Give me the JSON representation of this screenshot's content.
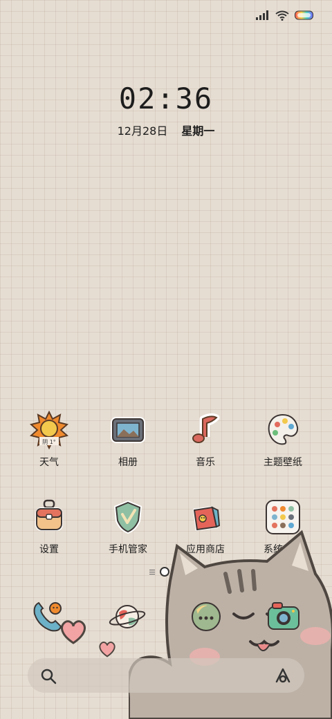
{
  "status_bar": {
    "icons": [
      "signal-icon",
      "wifi-icon",
      "battery-icon"
    ]
  },
  "lockclock": {
    "time": "02:36",
    "date": "12月28日",
    "weekday": "星期一"
  },
  "apps": [
    {
      "label": "天气",
      "icon": "weather-sun-icon",
      "badge": "阴 1°"
    },
    {
      "label": "相册",
      "icon": "gallery-icon"
    },
    {
      "label": "音乐",
      "icon": "music-note-icon"
    },
    {
      "label": "主题壁纸",
      "icon": "palette-icon"
    },
    {
      "label": "设置",
      "icon": "settings-bag-icon"
    },
    {
      "label": "手机管家",
      "icon": "shield-check-icon"
    },
    {
      "label": "应用商店",
      "icon": "app-store-bag-icon"
    },
    {
      "label": "系统工具",
      "icon": "folder-icon"
    }
  ],
  "dock": [
    {
      "icon": "phone-icon"
    },
    {
      "icon": "browser-planet-icon"
    },
    {
      "icon": "messages-icon"
    },
    {
      "icon": "camera-icon"
    }
  ],
  "page_indicator": {
    "current": 1,
    "total": 2
  },
  "search": {
    "icon": "search-icon",
    "assistant_icon": "assistant-icon"
  },
  "colors": {
    "background": "#e6ddd2",
    "cat": "#bfb3a8",
    "text": "#1d1d1d"
  }
}
